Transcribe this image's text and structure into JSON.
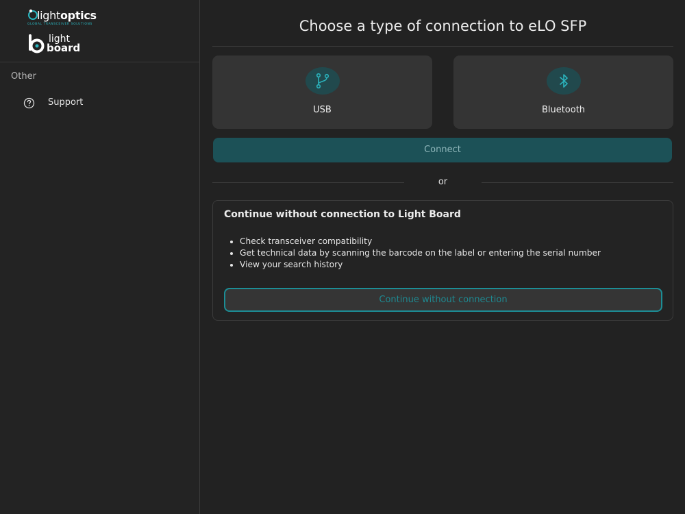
{
  "sidebar": {
    "logo_primary": {
      "part1": "light",
      "part2": "optics",
      "tagline": "GLOBAL TRANSCEIVER SOLUTIONS"
    },
    "logo_secondary": {
      "line1": "light",
      "line2": "board"
    },
    "section_label": "Other",
    "items": [
      {
        "label": "Support",
        "icon": "help-circle-icon"
      }
    ]
  },
  "main": {
    "title": "Choose a type of connection to eLO SFP",
    "connections": [
      {
        "label": "USB",
        "icon": "usb-branch-icon"
      },
      {
        "label": "Bluetooth",
        "icon": "bluetooth-icon"
      }
    ],
    "connect_label": "Connect",
    "or_label": "or",
    "offline": {
      "title": "Continue without connection to Light Board",
      "bullets": [
        "Check transceiver compatibility",
        "Get technical data by scanning the barcode on the label or entering the serial number",
        "View your search history"
      ],
      "button_label": "Continue without connection"
    }
  },
  "colors": {
    "background": "#222222",
    "accent": "#1c8e96",
    "connect_button": "#1c5157",
    "card": "#343434"
  }
}
